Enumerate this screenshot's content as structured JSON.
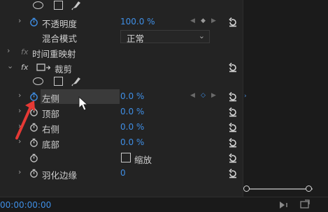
{
  "rows": {
    "opacity": {
      "label": "不透明度",
      "value": "100.0 %"
    },
    "blend": {
      "label": "混合模式",
      "value": "正常"
    },
    "time_remap": {
      "label": "时间重映射",
      "fx": "fx"
    },
    "crop": {
      "label": "裁剪",
      "fx": "fx"
    },
    "left": {
      "label": "左侧",
      "value": "0.0 %"
    },
    "top": {
      "label": "顶部",
      "value": "0.0 %"
    },
    "right": {
      "label": "右侧",
      "value": "0.0 %"
    },
    "bottom": {
      "label": "底部",
      "value": "0.0 %"
    },
    "zoom": {
      "label": "缩放"
    },
    "feather": {
      "label": "羽化边缘",
      "value": "0"
    }
  },
  "footer": {
    "timecode": "00:00:00:00"
  },
  "colors": {
    "accent": "#3f8fe6",
    "annotation_arrow": "#e53935"
  },
  "icons": [
    "ellipse-mask-icon",
    "rect-mask-icon",
    "pen-mask-icon",
    "stopwatch-icon",
    "reset-icon",
    "chevron-right-icon",
    "chevron-down-icon",
    "keyframe-icon",
    "cursor-icon",
    "arrow-annotation-icon"
  ]
}
